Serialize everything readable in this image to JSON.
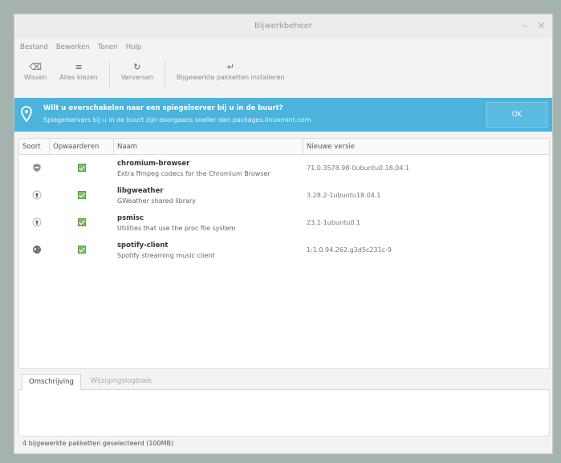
{
  "window": {
    "title": "Bijwerkbeheer",
    "controls": [
      "–",
      "×"
    ]
  },
  "menu": [
    "Bestand",
    "Bewerken",
    "Tonen",
    "Hulp"
  ],
  "toolbar": [
    {
      "label": "Wissen",
      "icon": "clear-icon"
    },
    {
      "label": "Alles kiezen",
      "icon": "select-all-icon"
    },
    {
      "label": "Verversen",
      "icon": "refresh-icon"
    },
    {
      "label": "Bijgewerkte pakketten installeren",
      "icon": "install-icon"
    }
  ],
  "infobar": {
    "title": "Wilt u overschakelen naar een spiegelserver bij u in de buurt?",
    "text": "Spiegelservers bij u in de buurt zijn doorgaans sneller dan packages.linuxmint.com",
    "ok_label": "OK",
    "icon": "location-pin-icon",
    "color": "#4cb3dd"
  },
  "table": {
    "headers": [
      "Soort",
      "Opwaarderen",
      "Naam",
      "Nieuwe versie"
    ],
    "rows": [
      {
        "type_icon": "shield-icon",
        "checked": true,
        "name": "chromium-browser",
        "description": "Extra ffmpeg codecs for the Chromium Browser",
        "version": "71.0.3578.98-0ubuntu0.18.04.1"
      },
      {
        "type_icon": "package-icon",
        "checked": true,
        "name": "libgweather",
        "description": "GWeather shared library",
        "version": "3.28.2-1ubuntu18.04.1"
      },
      {
        "type_icon": "package-icon",
        "checked": true,
        "name": "psmisc",
        "description": "Utilities that use the proc file system",
        "version": "23.1-1ubuntu0.1"
      },
      {
        "type_icon": "globe-icon",
        "checked": true,
        "name": "spotify-client",
        "description": "Spotify streaming music client",
        "version": "1:1.0.94.262.g3d5c231c-9"
      }
    ]
  },
  "tabs": [
    "Omschrijving",
    "Wijzigingslogboek"
  ],
  "status": "4 bijgewerkte pakketten geselecteerd (100MB)"
}
